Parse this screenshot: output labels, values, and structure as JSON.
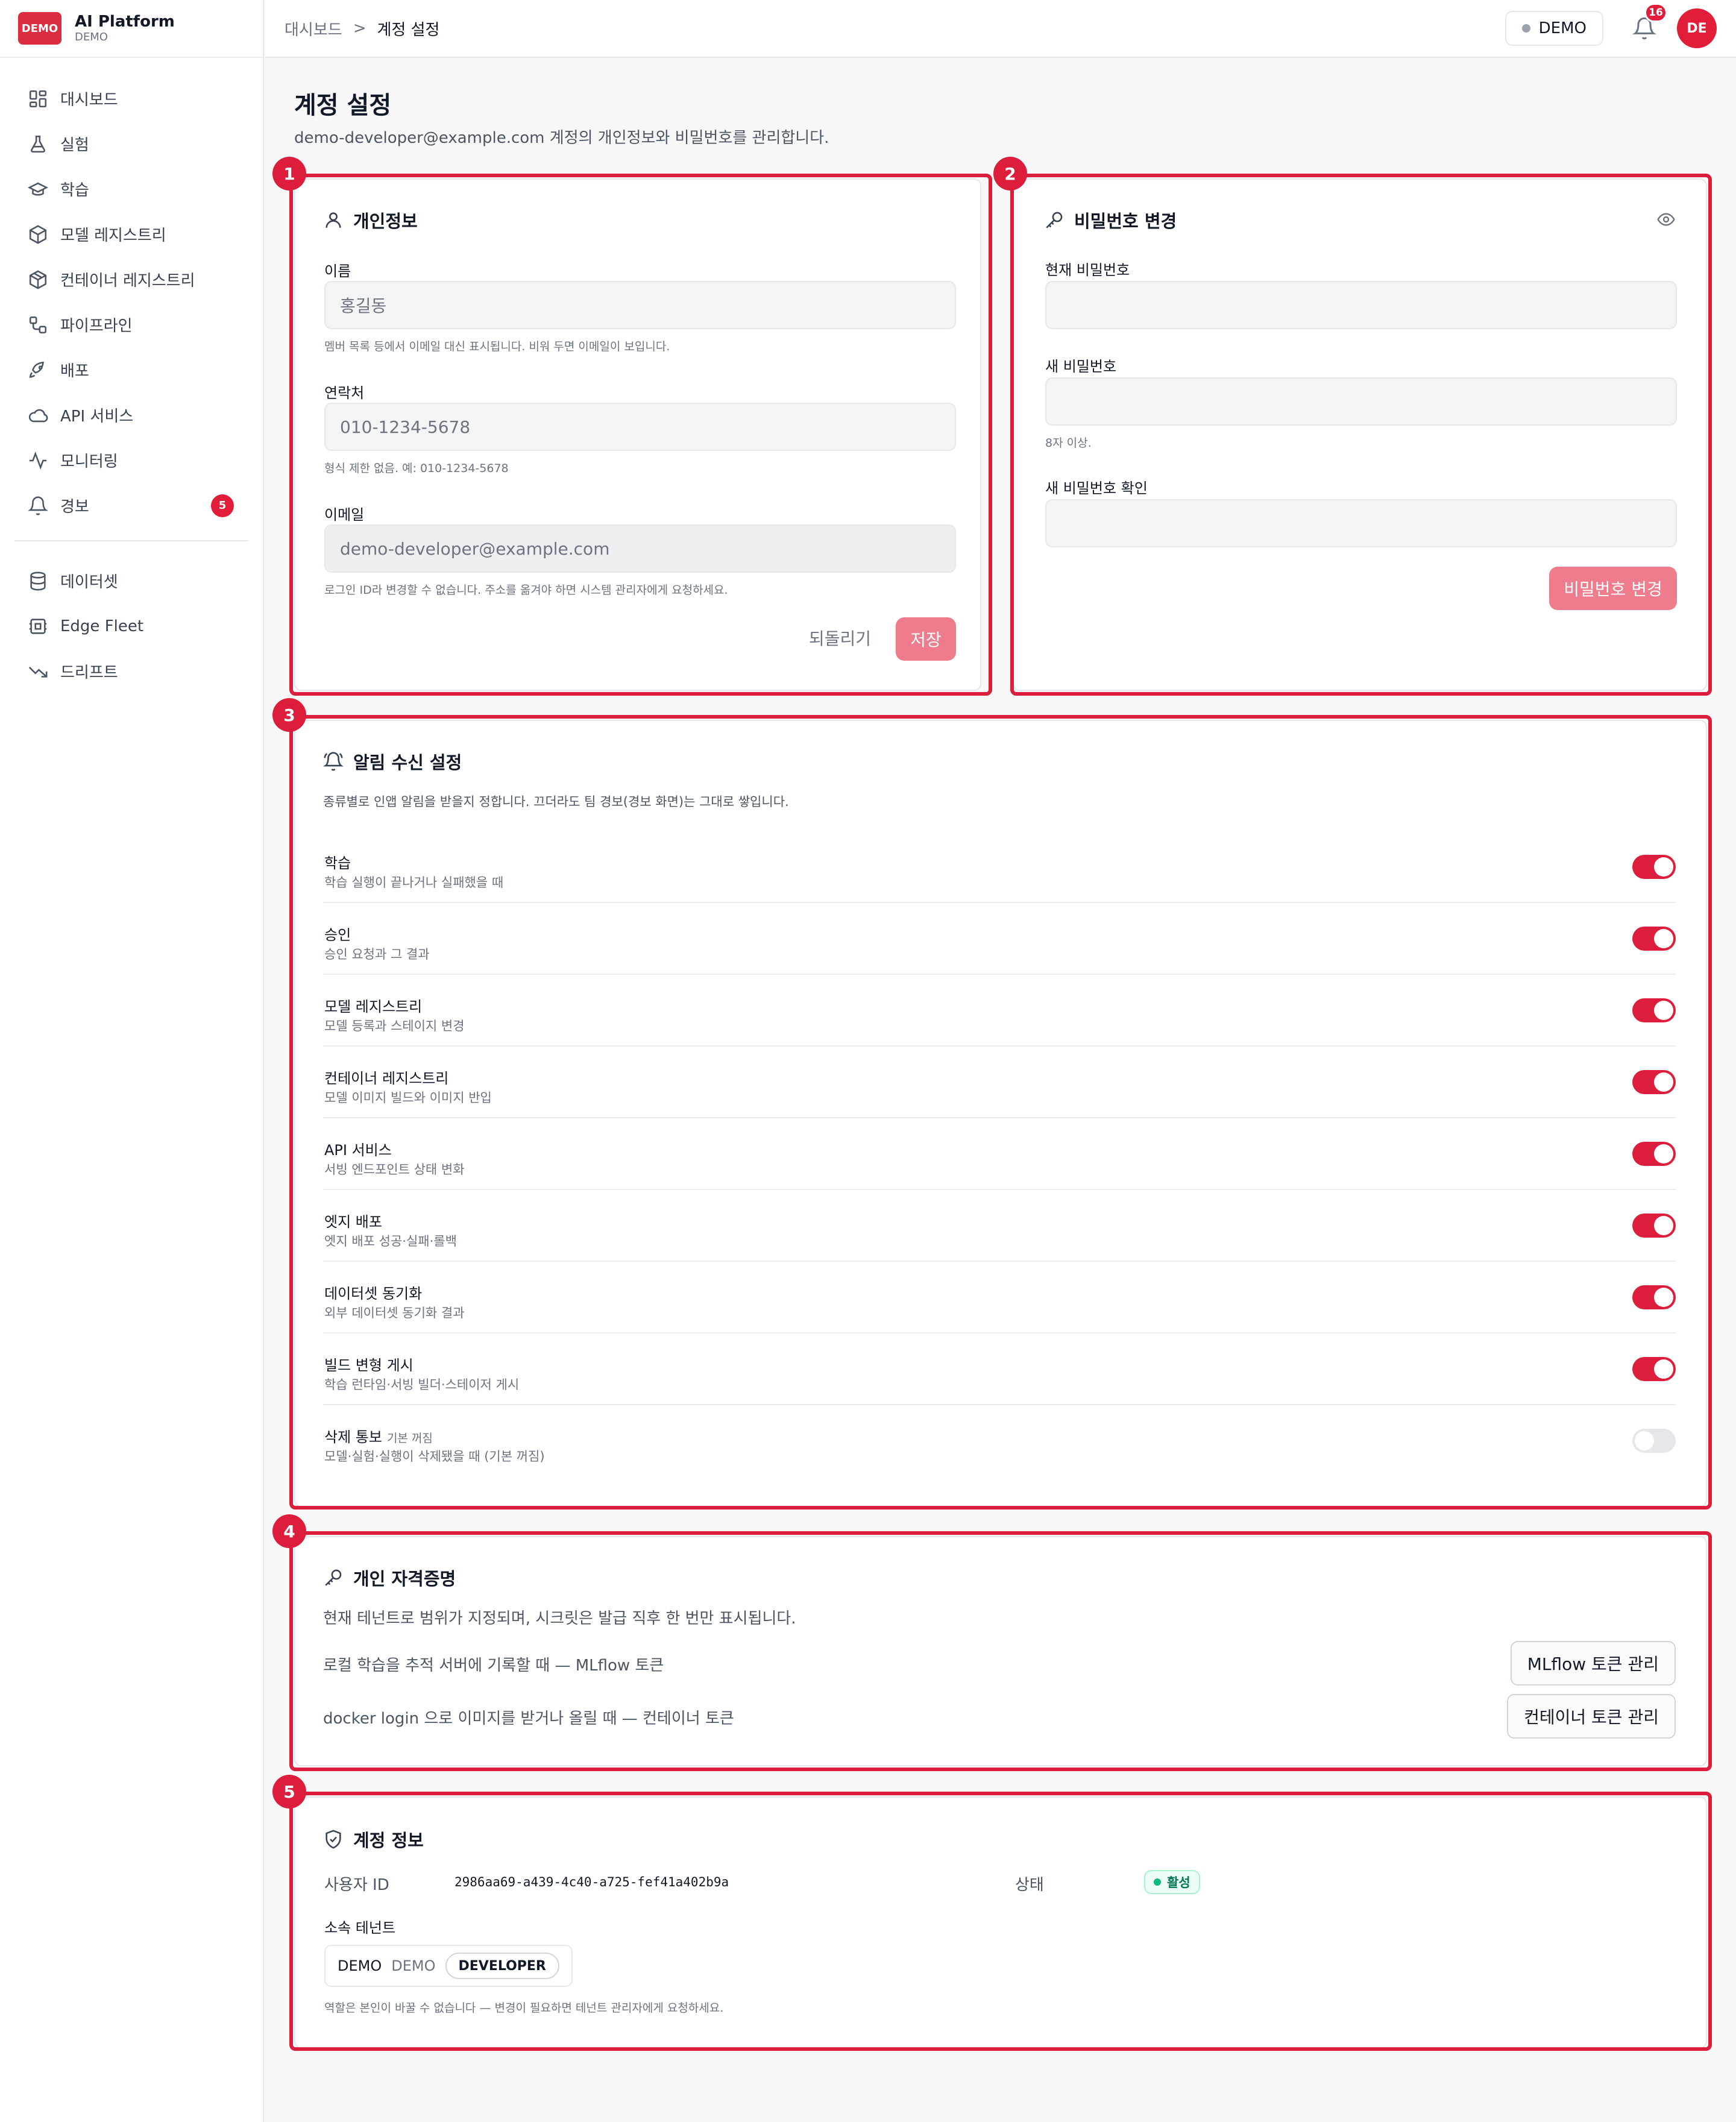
{
  "brand": {
    "logo": "DEMO",
    "name": "AI Platform",
    "sub": "DEMO"
  },
  "sidebar": {
    "items": [
      {
        "label": "대시보드",
        "icon": "dashboard-icon"
      },
      {
        "label": "실험",
        "icon": "flask-icon"
      },
      {
        "label": "학습",
        "icon": "graduation-cap-icon"
      },
      {
        "label": "모델 레지스트리",
        "icon": "cube-icon"
      },
      {
        "label": "컨테이너 레지스트리",
        "icon": "package-icon"
      },
      {
        "label": "파이프라인",
        "icon": "workflow-icon"
      },
      {
        "label": "배포",
        "icon": "rocket-icon"
      },
      {
        "label": "API 서비스",
        "icon": "cloud-icon"
      },
      {
        "label": "모니터링",
        "icon": "activity-icon"
      },
      {
        "label": "경보",
        "icon": "bell-icon",
        "badge": "5"
      }
    ],
    "secondary": [
      {
        "label": "데이터셋",
        "icon": "database-icon"
      },
      {
        "label": "Edge Fleet",
        "icon": "cpu-icon"
      },
      {
        "label": "드리프트",
        "icon": "trend-down-icon"
      }
    ]
  },
  "header": {
    "breadcrumb_root": "대시보드",
    "breadcrumb_sep": ">",
    "breadcrumb_current": "계정 설정",
    "tenant": "DEMO",
    "notification_count": "16",
    "avatar": "DE"
  },
  "page": {
    "title": "계정 설정",
    "subtitle": "demo-developer@example.com 계정의 개인정보와 비밀번호를 관리합니다."
  },
  "markers": [
    "1",
    "2",
    "3",
    "4",
    "5"
  ],
  "profile": {
    "title": "개인정보",
    "name_label": "이름",
    "name_value": "홍길동",
    "name_help": "멤버 목록 등에서 이메일 대신 표시됩니다. 비워 두면 이메일이 보입니다.",
    "phone_label": "연락처",
    "phone_value": "010-1234-5678",
    "phone_help": "형식 제한 없음. 예: 010-1234-5678",
    "email_label": "이메일",
    "email_value": "demo-developer@example.com",
    "email_help": "로그인 ID라 변경할 수 없습니다. 주소를 옮겨야 하면 시스템 관리자에게 요청하세요.",
    "reset_label": "되돌리기",
    "save_label": "저장"
  },
  "password": {
    "title": "비밀번호 변경",
    "current_label": "현재 비밀번호",
    "new_label": "새 비밀번호",
    "new_help": "8자 이상.",
    "confirm_label": "새 비밀번호 확인",
    "submit_label": "비밀번호 변경"
  },
  "notifications": {
    "title": "알림 수신 설정",
    "description": "종류별로 인앱 알림을 받을지 정합니다. 끄더라도 팀 경보(경보 화면)는 그대로 쌓입니다.",
    "items": [
      {
        "name": "학습",
        "note": "",
        "sub": "학습 실행이 끝나거나 실패했을 때",
        "on": true
      },
      {
        "name": "승인",
        "note": "",
        "sub": "승인 요청과 그 결과",
        "on": true
      },
      {
        "name": "모델 레지스트리",
        "note": "",
        "sub": "모델 등록과 스테이지 변경",
        "on": true
      },
      {
        "name": "컨테이너 레지스트리",
        "note": "",
        "sub": "모델 이미지 빌드와 이미지 반입",
        "on": true
      },
      {
        "name": "API 서비스",
        "note": "",
        "sub": "서빙 엔드포인트 상태 변화",
        "on": true
      },
      {
        "name": "엣지 배포",
        "note": "",
        "sub": "엣지 배포 성공·실패·롤백",
        "on": true
      },
      {
        "name": "데이터셋 동기화",
        "note": "",
        "sub": "외부 데이터셋 동기화 결과",
        "on": true
      },
      {
        "name": "빌드 변형 게시",
        "note": "",
        "sub": "학습 런타임·서빙 빌더·스테이저 게시",
        "on": true
      },
      {
        "name": "삭제 통보",
        "note": "기본 꺼짐",
        "sub": "모델·실험·실행이 삭제됐을 때 (기본 꺼짐)",
        "on": false
      }
    ]
  },
  "credentials": {
    "title": "개인 자격증명",
    "description": "현재 테넌트로 범위가 지정되며, 시크릿은 발급 직후 한 번만 표시됩니다.",
    "mlflow_text": "로컬 학습을 추적 서버에 기록할 때 — MLflow 토큰",
    "mlflow_button": "MLflow 토큰 관리",
    "container_text": "docker login 으로 이미지를 받거나 올릴 때 — 컨테이너 토큰",
    "container_button": "컨테이너 토큰 관리"
  },
  "account": {
    "title": "계정 정보",
    "user_id_label": "사용자 ID",
    "user_id": "2986aa69-a439-4c40-a725-fef41a402b9a",
    "status_label": "상태",
    "status": "활성",
    "tenant_label": "소속 테넌트",
    "tenant_name": "DEMO",
    "tenant_code": "DEMO",
    "role": "DEVELOPER",
    "role_help": "역할은 본인이 바꿀 수 없습니다 — 변경이 필요하면 테넌트 관리자에게 요청하세요."
  },
  "colors": {
    "accent": "#dc1d3c",
    "primary_button": "#ee7c8c",
    "success": "#10b981"
  }
}
